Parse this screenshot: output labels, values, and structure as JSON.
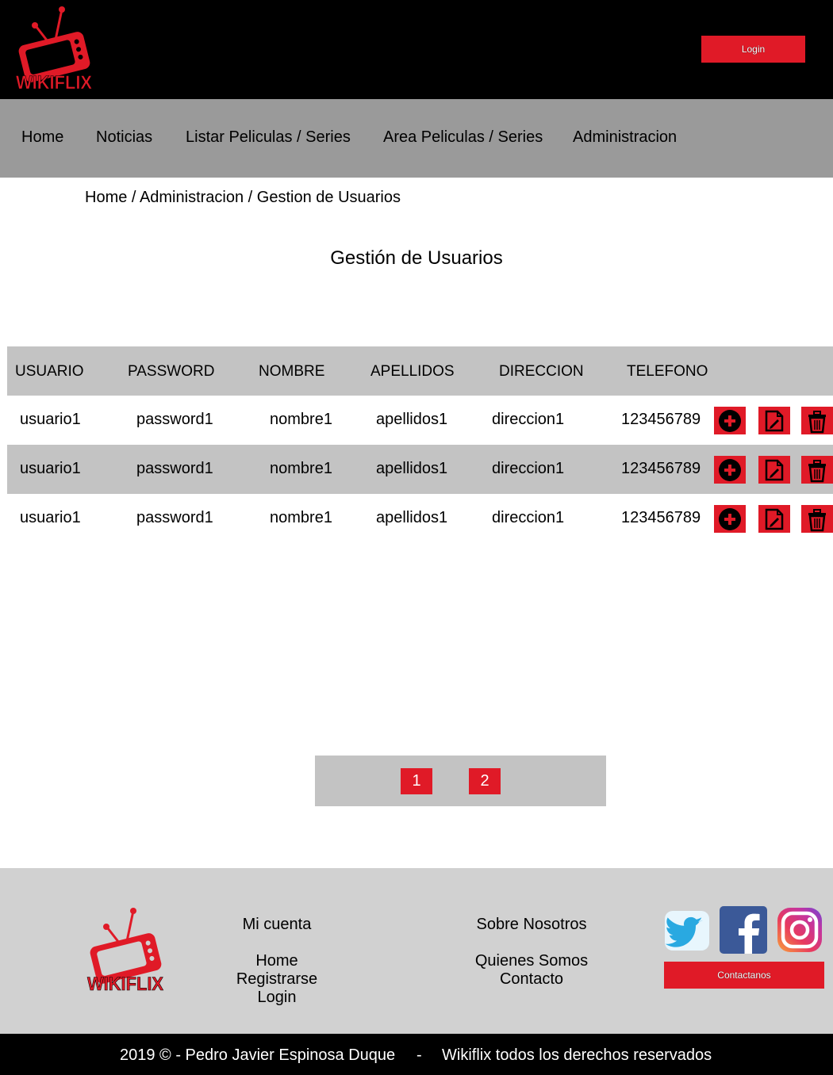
{
  "header": {
    "logo_text": "WIKIFLIX",
    "login_label": "Login"
  },
  "nav": {
    "items": [
      "Home",
      "Noticias",
      "Listar Peliculas / Series",
      "Area Peliculas / Series",
      "Administracion"
    ]
  },
  "breadcrumb": {
    "items": [
      "Home",
      "Administracion",
      "Gestion de Usuarios"
    ],
    "separator": " / "
  },
  "page_title": "Gestión de Usuarios",
  "table": {
    "columns": [
      "USUARIO",
      "PASSWORD",
      "NOMBRE",
      "APELLIDOS",
      "DIRECCION",
      "TELEFONO"
    ],
    "rows": [
      [
        "usuario1",
        "password1",
        "nombre1",
        "apellidos1",
        "direccion1",
        "123456789"
      ],
      [
        "usuario1",
        "password1",
        "nombre1",
        "apellidos1",
        "direccion1",
        "123456789"
      ],
      [
        "usuario1",
        "password1",
        "nombre1",
        "apellidos1",
        "direccion1",
        "123456789"
      ]
    ],
    "row_actions": [
      "add-icon",
      "edit-icon",
      "delete-icon"
    ]
  },
  "pagination": {
    "pages": [
      "1",
      "2"
    ]
  },
  "footer": {
    "logo_text": "WIKIFLIX",
    "account": {
      "title": "Mi cuenta",
      "links": [
        "Home",
        "Registrarse",
        "Login"
      ]
    },
    "about": {
      "title": "Sobre Nosotros",
      "links": [
        "Quienes Somos",
        "Contacto"
      ]
    },
    "social_icons": [
      "twitter-icon",
      "facebook-icon",
      "instagram-icon"
    ],
    "contact_label": "Contactanos"
  },
  "bottom_bar": {
    "copyright": "2019 © - Pedro Javier Espinosa Duque",
    "separator": "-",
    "rights": "Wikiflix todos los derechos reservados"
  },
  "colors": {
    "brand_red": "#e01a27",
    "header_bg": "#000000",
    "nav_bg": "#9a9a9a",
    "table_stripe": "#c3c3c3",
    "footer_bg": "#d1d1d1"
  }
}
